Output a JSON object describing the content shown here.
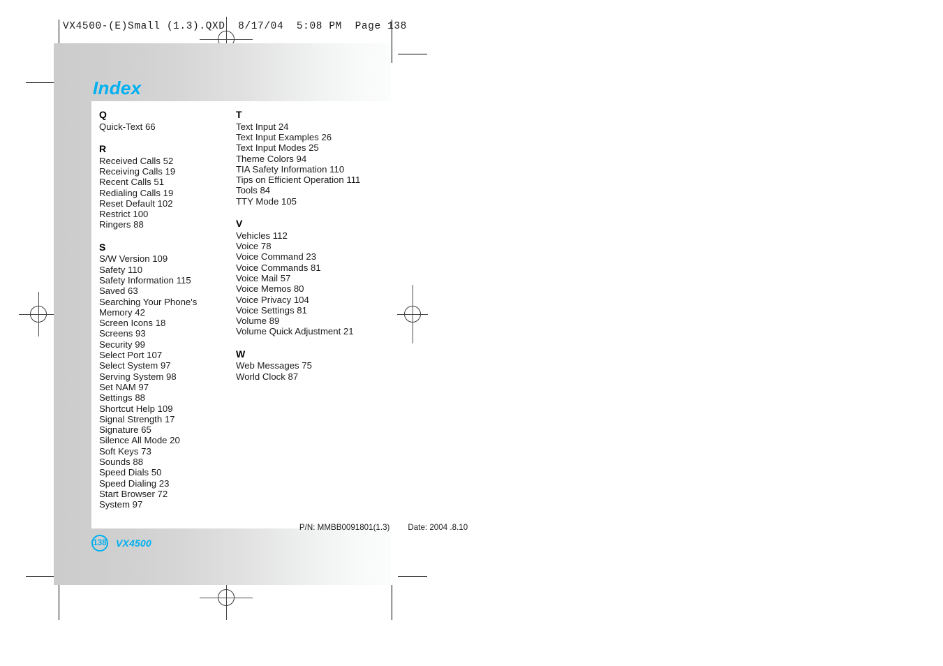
{
  "prepress": {
    "header_line": "VX4500-(E)Small (1.3).QXD  8/17/04  5:08 PM  Page 138"
  },
  "page": {
    "title": "Index",
    "number": "138",
    "model": "VX4500",
    "accent_color": "#00b0f0"
  },
  "imprint": {
    "part_number": "P/N: MMBB0091801(1.3)",
    "date": "Date: 2004 .8.10"
  },
  "index": {
    "columns": [
      {
        "groups": [
          {
            "letter": "Q",
            "entries": [
              "Quick-Text 66"
            ]
          },
          {
            "letter": "R",
            "entries": [
              "Received Calls 52",
              "Receiving Calls 19",
              "Recent Calls 51",
              "Redialing Calls 19",
              "Reset Default 102",
              "Restrict 100",
              "Ringers 88"
            ]
          },
          {
            "letter": "S",
            "entries": [
              "S/W Version 109",
              "Safety 110",
              "Safety Information 115",
              "Saved 63",
              "Searching Your Phone's Memory 42",
              "Screen Icons 18",
              "Screens 93",
              "Security 99",
              "Select Port 107",
              "Select System 97",
              "Serving System 98",
              "Set NAM 97",
              "Settings 88",
              "Shortcut Help 109",
              "Signal Strength 17",
              "Signature 65",
              "Silence All Mode 20",
              "Soft Keys 73",
              "Sounds 88",
              "Speed Dials 50",
              "Speed Dialing 23",
              "Start Browser 72",
              "System 97"
            ]
          }
        ]
      },
      {
        "groups": [
          {
            "letter": "T",
            "entries": [
              "Text Input 24",
              "Text Input Examples 26",
              "Text Input Modes 25",
              "Theme Colors 94",
              "TIA Safety Information 110",
              "Tips on Efficient Operation 111",
              "Tools 84",
              "TTY Mode 105"
            ]
          },
          {
            "letter": "V",
            "entries": [
              "Vehicles 112",
              "Voice 78",
              "Voice Command 23",
              "Voice Commands 81",
              "Voice Mail 57",
              "Voice Memos 80",
              "Voice Privacy 104",
              "Voice Settings 81",
              "Volume 89",
              "Volume Quick Adjustment 21"
            ]
          },
          {
            "letter": "W",
            "entries": [
              "Web Messages 75",
              "World Clock 87"
            ]
          }
        ]
      }
    ]
  }
}
